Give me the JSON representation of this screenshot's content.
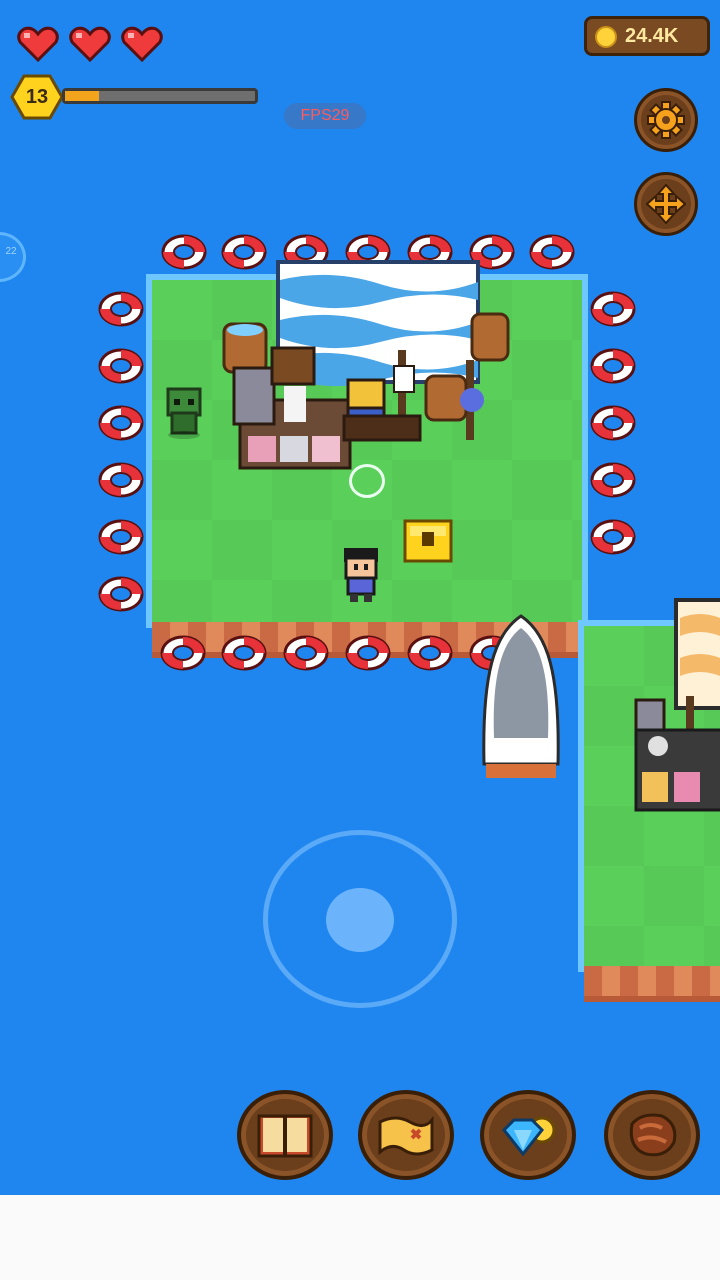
{
  "hud": {
    "hearts": [
      "heart",
      "heart",
      "heart"
    ],
    "level": "13",
    "xp_progress": 0.18,
    "fps_label": "FPS29",
    "coins": "24.4K",
    "side_tab_label": "22"
  },
  "colors": {
    "water": "#1f86f0",
    "grass": "#5ad05a",
    "awning_stripe": "#4aa6e6",
    "heart_red": "#ef3b3b",
    "coin_gold": "#ffd23a",
    "button_brown": "#6b3e1c"
  },
  "buttons": {
    "settings": "gear-icon",
    "move": "arrows-move-icon",
    "dock": [
      "book-icon",
      "map-icon",
      "gem-shop-icon",
      "meat-icon"
    ]
  }
}
